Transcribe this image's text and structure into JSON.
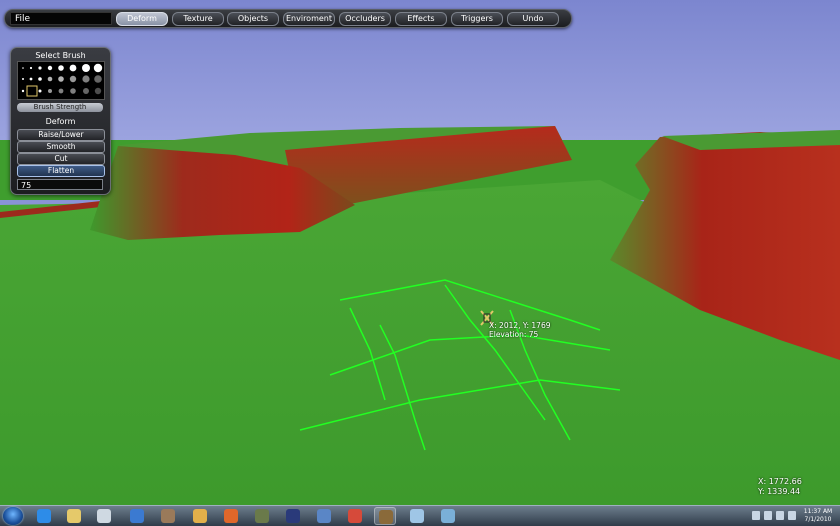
{
  "window": {
    "title": "File"
  },
  "menu": {
    "items": [
      {
        "label": "Deform",
        "active": true
      },
      {
        "label": "Texture",
        "active": false
      },
      {
        "label": "Objects",
        "active": false
      },
      {
        "label": "Enviroment",
        "active": false
      },
      {
        "label": "Occluders",
        "active": false
      },
      {
        "label": "Effects",
        "active": false
      },
      {
        "label": "Triggers",
        "active": false
      },
      {
        "label": "Undo",
        "active": false
      }
    ]
  },
  "brush_panel": {
    "title": "Select Brush",
    "strength_label": "Brush Strength",
    "mode_label": "Deform",
    "buttons": [
      {
        "label": "Raise/Lower",
        "active": false
      },
      {
        "label": "Smooth",
        "active": false
      },
      {
        "label": "Cut",
        "active": false
      },
      {
        "label": "Flatten",
        "active": true
      }
    ],
    "value": "75"
  },
  "cursor": {
    "position_text": "X: 2012, Y: 1769",
    "elevation_text": "Elevation: 75"
  },
  "coordinates": {
    "x_text": "X: 1772.66",
    "y_text": "Y: 1339.44"
  },
  "taskbar": {
    "time": "11:37 AM",
    "date": "7/1/2010",
    "icons": [
      {
        "name": "ie-icon",
        "color": "#2d8ce8"
      },
      {
        "name": "folder-icon",
        "color": "#e5c96a"
      },
      {
        "name": "notepad-icon",
        "color": "#cfd9e2"
      },
      {
        "name": "display-icon",
        "color": "#3b7ad1"
      },
      {
        "name": "app-icon",
        "color": "#9a7a5a"
      },
      {
        "name": "pencil-icon",
        "color": "#e3b04a"
      },
      {
        "name": "firefox-icon",
        "color": "#e0672a"
      },
      {
        "name": "game-icon",
        "color": "#6a7a4a"
      },
      {
        "name": "library-icon",
        "color": "#2a3a7a"
      },
      {
        "name": "dragon-icon",
        "color": "#5a86c6"
      },
      {
        "name": "paint-icon",
        "color": "#d64a3a"
      },
      {
        "name": "mushroom-icon",
        "color": "#8a6a3a"
      },
      {
        "name": "globe-icon",
        "color": "#9fc6e6"
      },
      {
        "name": "network-icon",
        "color": "#7ab0d8"
      }
    ]
  },
  "colors": {
    "sky": "#8a93d6",
    "grass": "#3f9e2e",
    "slope_red": "#a8231b",
    "brush_grid": "#22ff22"
  }
}
